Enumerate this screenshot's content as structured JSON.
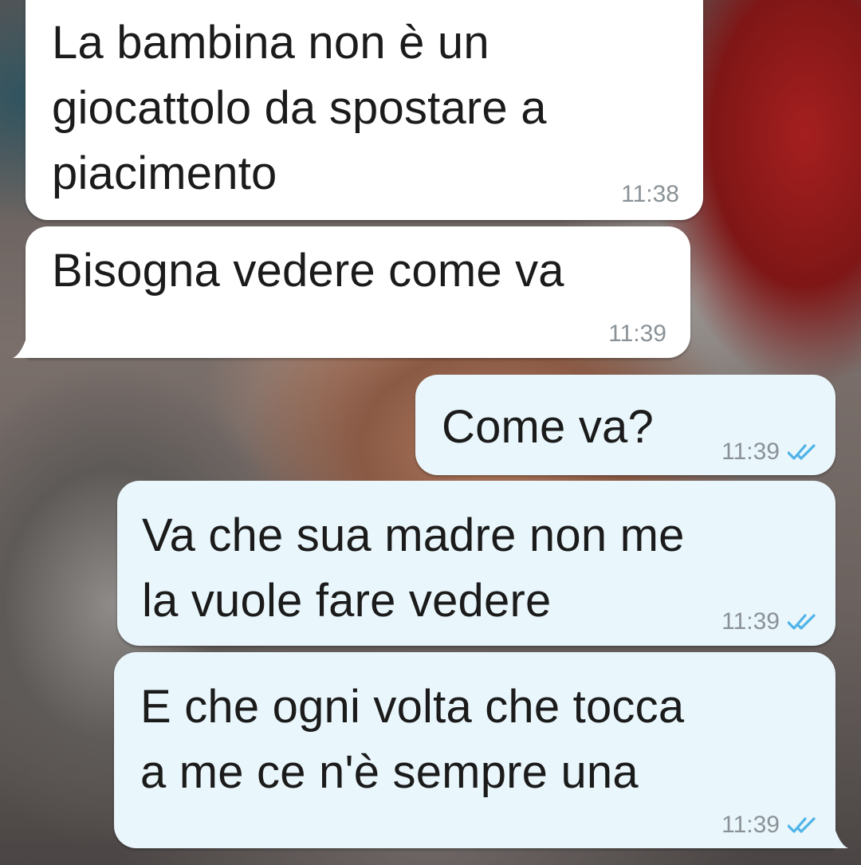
{
  "chat": {
    "messages": [
      {
        "direction": "incoming",
        "text": "La bambina non è un\ngiocattolo da spostare a\npiacimento",
        "time": "11:38"
      },
      {
        "direction": "incoming",
        "text": "Bisogna vedere come va",
        "time": "11:39"
      },
      {
        "direction": "outgoing",
        "text": "Come va?",
        "time": "11:39",
        "status": "read"
      },
      {
        "direction": "outgoing",
        "text": "Va che sua madre non me\nla vuole fare vedere",
        "time": "11:39",
        "status": "read"
      },
      {
        "direction": "outgoing",
        "text": "E che ogni volta che tocca\na me ce n'è sempre una",
        "time": "11:39",
        "status": "read"
      }
    ]
  },
  "colors": {
    "incoming_bubble": "#ffffff",
    "outgoing_bubble": "#e9f6fb",
    "read_ticks": "#4fb3e8",
    "timestamp": "#8a9297"
  },
  "icons": {
    "read_receipt": "double-check-icon"
  }
}
